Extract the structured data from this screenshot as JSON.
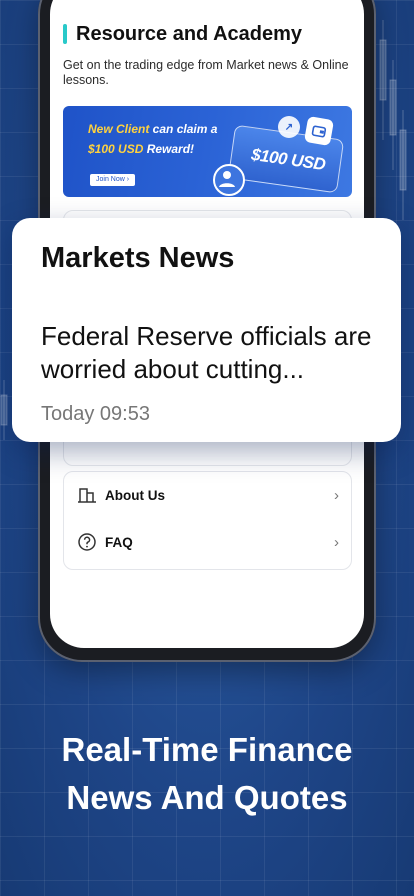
{
  "section": {
    "title": "Resource and Academy",
    "description": "Get on the trading edge from Market news & Online lessons."
  },
  "banner": {
    "line1_a": "New Client",
    "line1_b": " can claim a",
    "line2_a": "$100 USD",
    "line2_b": " Reward!",
    "join_label": "Join Now",
    "ticket_text": "$100 USD"
  },
  "news_card": {
    "title": "Markets News",
    "headline": "Federal Reserve officials are worried about cutting...",
    "time": "Today 09:53"
  },
  "menu": [
    {
      "label": "About Us",
      "icon": "building-icon"
    },
    {
      "label": "FAQ",
      "icon": "question-icon"
    }
  ],
  "tagline": {
    "line1": "Real-Time Finance",
    "line2": "News And Quotes"
  },
  "colors": {
    "background": "#1f4b8f",
    "accent": "#29c9c9",
    "banner": "#2b63d6",
    "banner_highlight": "#ffd23f"
  }
}
